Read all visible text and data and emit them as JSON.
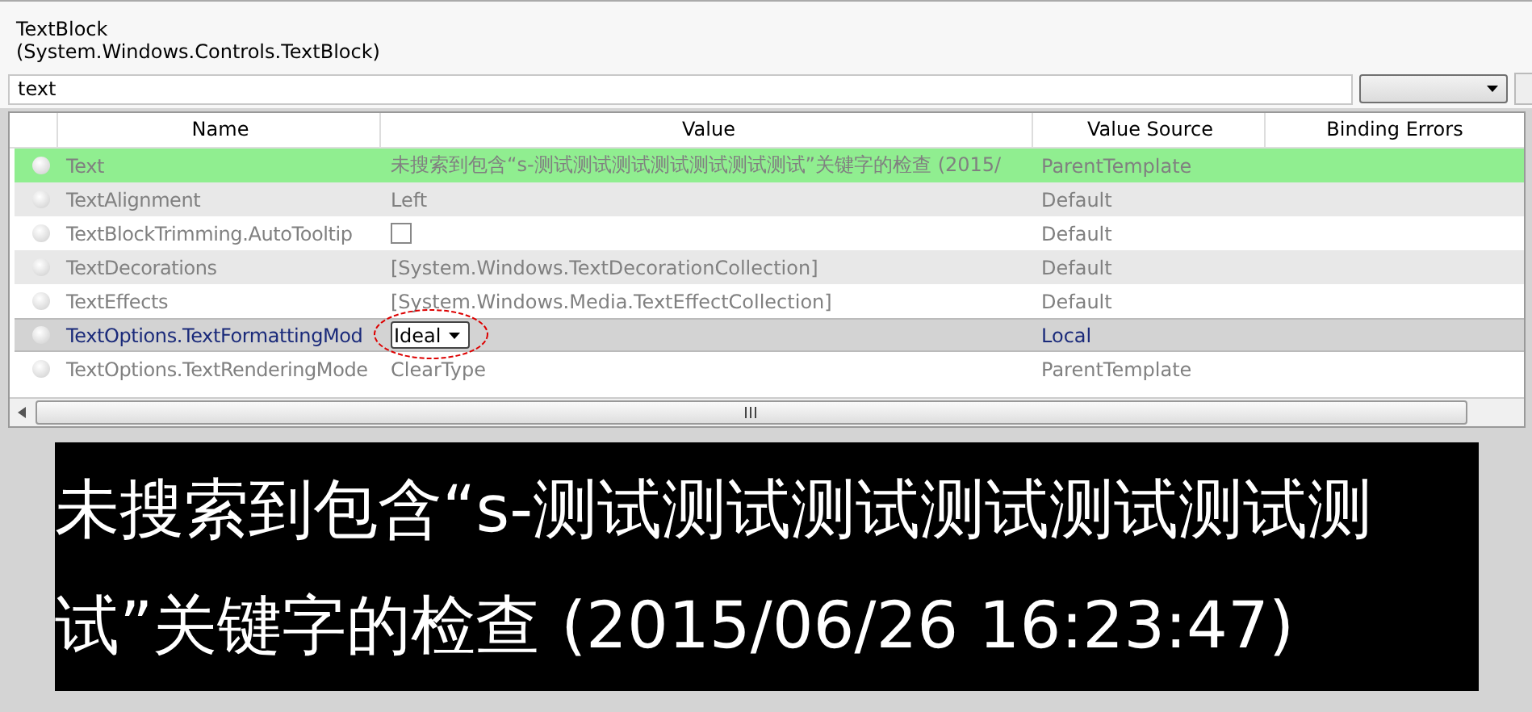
{
  "header": {
    "type_name": "TextBlock",
    "full_type": "(System.Windows.Controls.TextBlock)"
  },
  "search": {
    "value": "text"
  },
  "columns": [
    "Name",
    "Value",
    "Value Source",
    "Binding Errors"
  ],
  "rows": [
    {
      "name": "Text",
      "kind": "text",
      "value": "未搜索到包含“s-测试测试测试测试测试测试测试”关键字的检查 (2015/",
      "value_source": "ParentTemplate",
      "matched": true,
      "selected": false,
      "circled": false
    },
    {
      "name": "TextAlignment",
      "kind": "text",
      "value": "Left",
      "value_source": "Default",
      "matched": false,
      "selected": false,
      "circled": false
    },
    {
      "name": "TextBlockTrimming.AutoTooltip",
      "kind": "checkbox",
      "checked": false,
      "value_source": "Default",
      "matched": false,
      "selected": false,
      "circled": false
    },
    {
      "name": "TextDecorations",
      "kind": "text",
      "value": "[System.Windows.TextDecorationCollection]",
      "value_source": "Default",
      "matched": false,
      "selected": false,
      "circled": false
    },
    {
      "name": "TextEffects",
      "kind": "text",
      "value": "[System.Windows.Media.TextEffectCollection]",
      "value_source": "Default",
      "matched": false,
      "selected": false,
      "circled": false
    },
    {
      "name": "TextOptions.TextFormattingMod",
      "kind": "combo",
      "value": "Ideal",
      "value_source": "Local",
      "matched": false,
      "selected": true,
      "circled": true
    },
    {
      "name": "TextOptions.TextRenderingMode",
      "kind": "text",
      "value": "ClearType",
      "value_source": "ParentTemplate",
      "matched": false,
      "selected": false,
      "circled": false
    }
  ],
  "caption": "未搜索到包含“s-测试测试测试测试测试测试测试”关键字的检查 (2015/06/26 16:23:47)"
}
